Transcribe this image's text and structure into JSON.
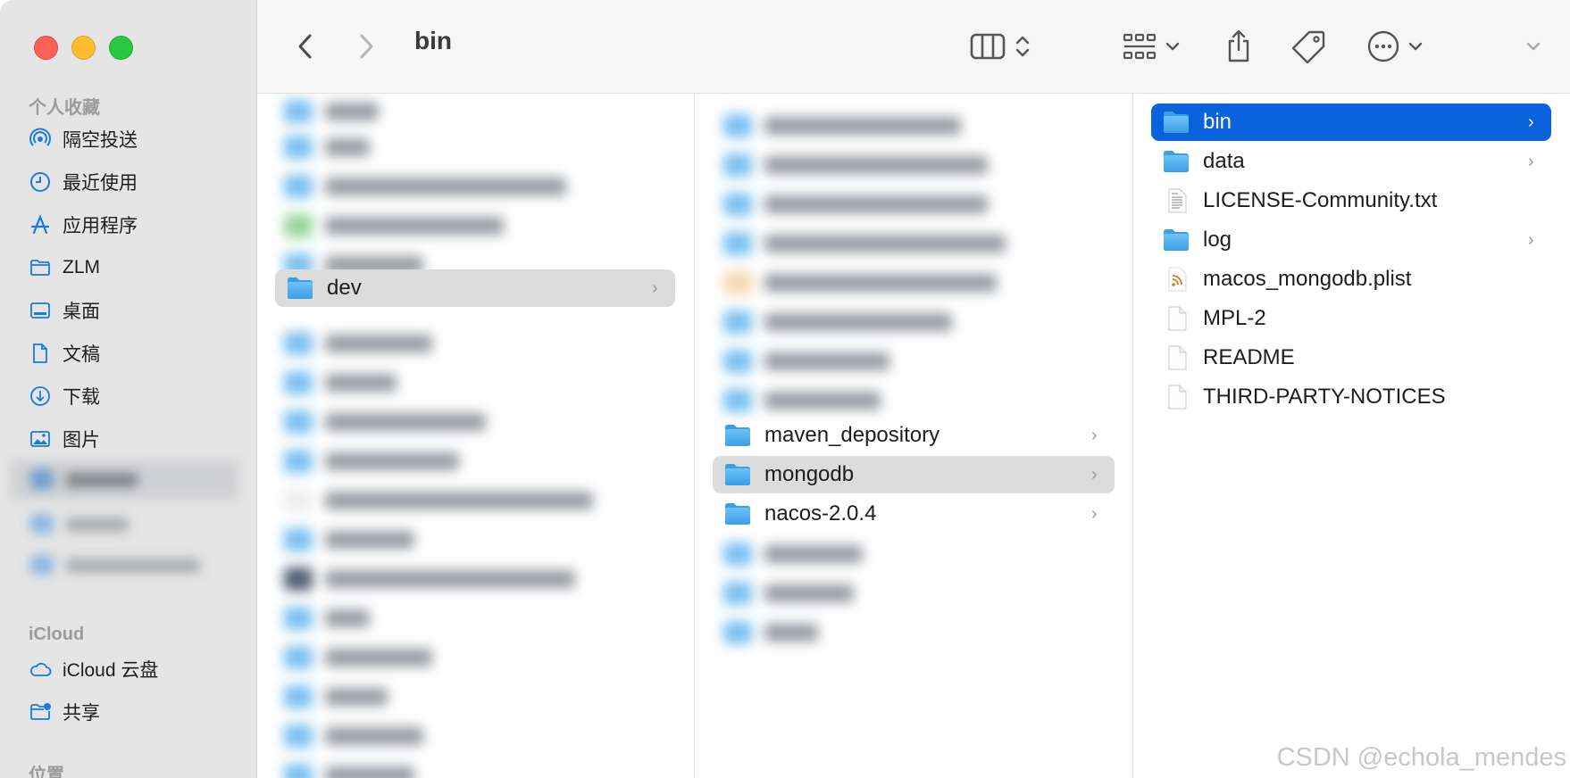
{
  "window": {
    "title": "bin"
  },
  "sidebar": {
    "favorites_header": "个人收藏",
    "favorites": [
      {
        "label": "隔空投送",
        "icon": "airdrop-icon"
      },
      {
        "label": "最近使用",
        "icon": "clock-icon"
      },
      {
        "label": "应用程序",
        "icon": "applications-icon"
      },
      {
        "label": "ZLM",
        "icon": "folder-icon"
      },
      {
        "label": "桌面",
        "icon": "desktop-icon"
      },
      {
        "label": "文稿",
        "icon": "document-icon"
      },
      {
        "label": "下载",
        "icon": "download-icon"
      },
      {
        "label": "图片",
        "icon": "photo-icon"
      }
    ],
    "icloud_header": "iCloud",
    "icloud": [
      {
        "label": "iCloud 云盘",
        "icon": "icloud-icon"
      },
      {
        "label": "共享",
        "icon": "shared-folder-icon"
      }
    ],
    "locations_header": "位置"
  },
  "column1": {
    "selected": "dev"
  },
  "column2": {
    "items": [
      {
        "name": "maven_depository",
        "type": "folder"
      },
      {
        "name": "mongodb",
        "type": "folder",
        "selected": true
      },
      {
        "name": "nacos-2.0.4",
        "type": "folder"
      }
    ]
  },
  "column3": {
    "items": [
      {
        "name": "bin",
        "type": "folder",
        "selected": true
      },
      {
        "name": "data",
        "type": "folder"
      },
      {
        "name": "LICENSE-Community.txt",
        "type": "text"
      },
      {
        "name": "log",
        "type": "folder"
      },
      {
        "name": "macos_mongodb.plist",
        "type": "plist"
      },
      {
        "name": "MPL-2",
        "type": "file"
      },
      {
        "name": "README",
        "type": "file"
      },
      {
        "name": "THIRD-PARTY-NOTICES",
        "type": "file"
      }
    ]
  },
  "watermark": "CSDN @echola_mendes",
  "colors": {
    "accent": "#0a63dd",
    "folder": "#4aaef0",
    "selection_gray": "#dcdcdc"
  }
}
